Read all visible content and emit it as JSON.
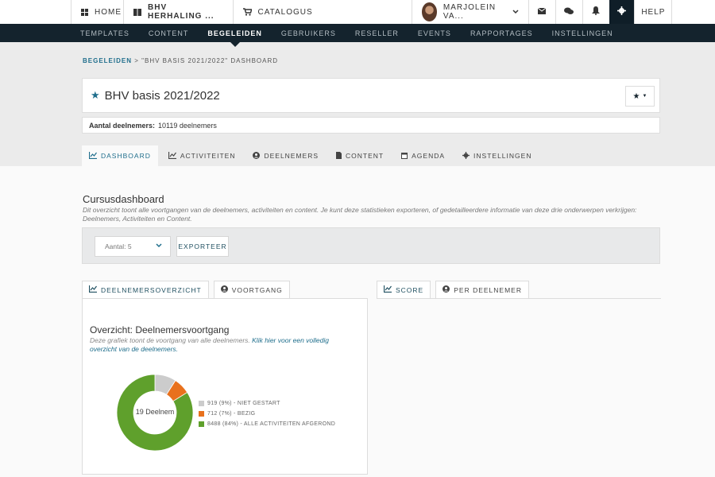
{
  "topbar": {
    "home_label": "HOME",
    "course_label": "BHV HERHALING ...",
    "catalog_label": "CATALOGUS",
    "user_name": "MARJOLEIN VA...",
    "help_label": "HELP"
  },
  "nav": {
    "items": [
      "TEMPLATES",
      "CONTENT",
      "BEGELEIDEN",
      "GEBRUIKERS",
      "RESELLER",
      "EVENTS",
      "RAPPORTAGES",
      "INSTELLINGEN"
    ],
    "active": "BEGELEIDEN"
  },
  "breadcrumb": {
    "link": "BEGELEIDEN",
    "separator": ">",
    "current": "\"BHV BASIS 2021/2022\" DASHBOARD"
  },
  "course": {
    "title": "BHV basis 2021/2022",
    "participants_label": "Aantal deelnemers:",
    "participants_value": "10119 deelnemers"
  },
  "tabs": [
    "DASHBOARD",
    "ACTIVITEITEN",
    "DEELNEMERS",
    "CONTENT",
    "AGENDA",
    "INSTELLINGEN"
  ],
  "dashboard": {
    "title": "Cursusdashboard",
    "description": "Dit overzicht toont alle voortgangen van de deelnemers, activiteiten en content. Je kunt deze statistieken exporteren, of gedetailleerdere informatie van deze drie onderwerpen verkrijgen: Deelnemers, Activiteiten en Content.",
    "select_value": "Aantal: 5",
    "export_label": "EXPORTEER"
  },
  "subtabs_left": [
    "DEELNEMERSOVERZICHT",
    "VOORTGANG"
  ],
  "subtabs_right": [
    "SCORE",
    "PER DEELNEMER"
  ],
  "panel": {
    "title": "Overzicht: Deelnemersvoortgang",
    "desc_text": "Deze grafiek toont de voortgang van alle deelnemers.",
    "desc_link": "Klik hier voor een volledig overzicht van de deelnemers.",
    "donut_label": "19 Deelnem"
  },
  "chart_data": {
    "type": "pie",
    "categories": [
      "NIET GESTART",
      "BEZIG",
      "ALLE ACTIVITEITEN AFGEROND"
    ],
    "values": [
      919,
      712,
      8488
    ],
    "legend": [
      "919 (9%) - NIET GESTART",
      "712 (7%) - BEZIG",
      "8488 (84%) - ALLE ACTIVITEITEN AFGEROND"
    ],
    "colors": [
      "#cccccc",
      "#e8711d",
      "#5fa02c"
    ],
    "legend_position": "right"
  }
}
